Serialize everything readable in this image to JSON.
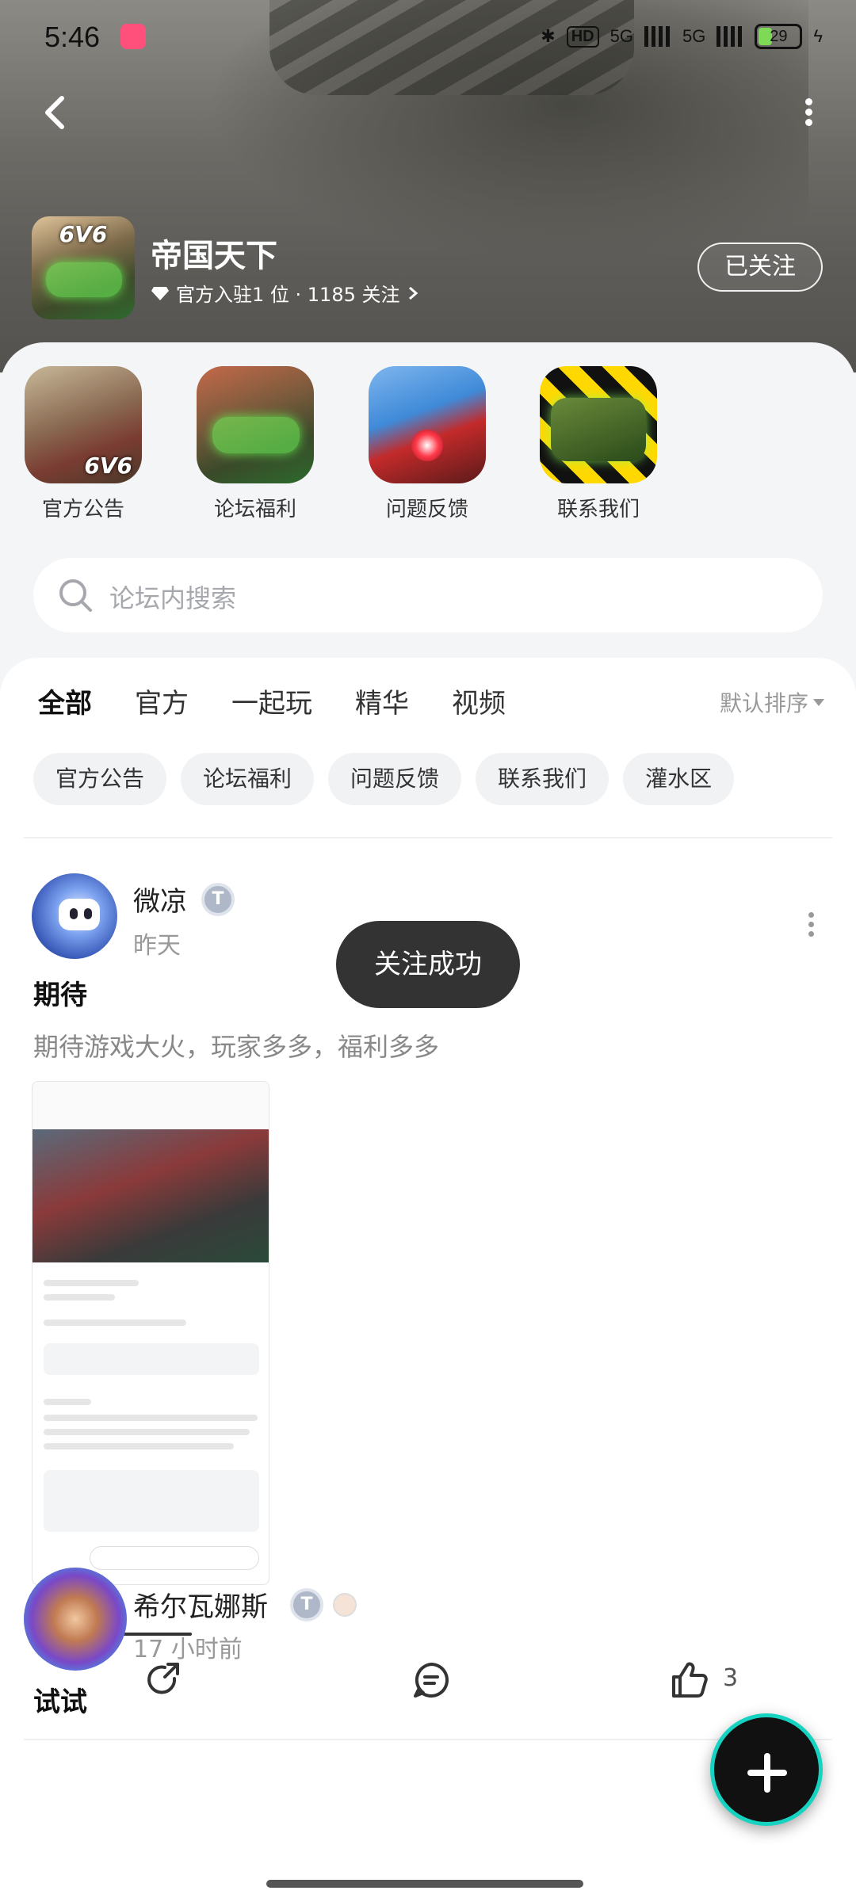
{
  "status_bar": {
    "time": "5:46",
    "hd": "HD",
    "net1": "5G",
    "net2": "5G",
    "battery": "29"
  },
  "header": {
    "game_title": "帝国天下",
    "game_icon_label": "6V6",
    "meta": "官方入驻1 位 · 1185 关注",
    "follow_button": "已关注"
  },
  "shortcuts": [
    {
      "label": "官方公告",
      "tag": "6V6"
    },
    {
      "label": "论坛福利"
    },
    {
      "label": "问题反馈"
    },
    {
      "label": "联系我们"
    }
  ],
  "search": {
    "placeholder": "论坛内搜索"
  },
  "tabs": [
    {
      "label": "全部",
      "active": true
    },
    {
      "label": "官方"
    },
    {
      "label": "一起玩"
    },
    {
      "label": "精华"
    },
    {
      "label": "视频"
    }
  ],
  "sort_label": "默认排序",
  "chips": [
    "官方公告",
    "论坛福利",
    "问题反馈",
    "联系我们",
    "灌水区"
  ],
  "posts": [
    {
      "username": "微凉",
      "badge": "T",
      "time": "昨天",
      "title": "期待",
      "body": "期待游戏大火，玩家多多，福利多多",
      "likes": "3"
    },
    {
      "username": "希尔瓦娜斯",
      "badge": "T",
      "time": "17 小时前",
      "title": "试试"
    }
  ],
  "toast": "关注成功",
  "colors": {
    "accent": "#18c5b9",
    "fab_ring": "#15d3c0"
  }
}
